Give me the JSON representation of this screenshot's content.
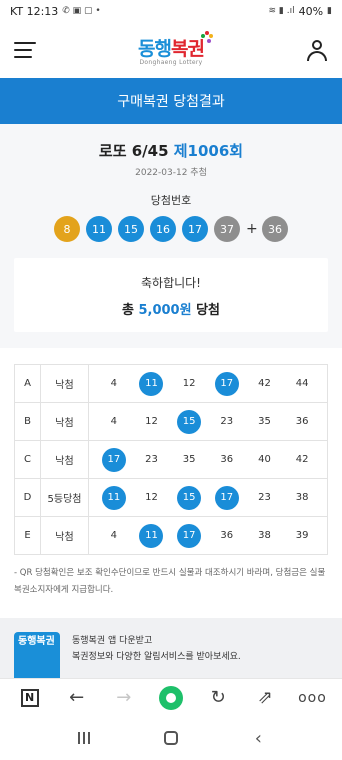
{
  "status_bar": {
    "carrier_time": "KT 12:13",
    "battery": "40%"
  },
  "header": {
    "logo_text_1": "동행",
    "logo_text_2": "복권",
    "logo_sub": "Donghaeng Lottery",
    "menu_icon": "hamburger-menu-icon",
    "user_icon": "user-icon"
  },
  "page_title": "구매복권 당첨결과",
  "draw": {
    "game": "로또 6/45",
    "round": "제1006회",
    "date": "2022-03-12 추첨",
    "winning_label": "당첨번호",
    "numbers": [
      {
        "n": "8",
        "color": "#e3a31c"
      },
      {
        "n": "11",
        "color": "#1a8dd8"
      },
      {
        "n": "15",
        "color": "#1a8dd8"
      },
      {
        "n": "16",
        "color": "#1a8dd8"
      },
      {
        "n": "17",
        "color": "#1a8dd8"
      },
      {
        "n": "37",
        "color": "#8e8e8e"
      }
    ],
    "plus": "+",
    "bonus": {
      "n": "36",
      "color": "#8e8e8e"
    }
  },
  "congrats": {
    "message": "축하합니다!",
    "prize_prefix": "총",
    "prize_amount": "5,000원",
    "prize_suffix": "당첨"
  },
  "ticket": {
    "rows": [
      {
        "letter": "A",
        "result": "낙첨",
        "numbers": [
          {
            "v": "4",
            "hit": false
          },
          {
            "v": "11",
            "hit": true
          },
          {
            "v": "12",
            "hit": false
          },
          {
            "v": "17",
            "hit": true
          },
          {
            "v": "42",
            "hit": false
          },
          {
            "v": "44",
            "hit": false
          }
        ]
      },
      {
        "letter": "B",
        "result": "낙첨",
        "numbers": [
          {
            "v": "4",
            "hit": false
          },
          {
            "v": "12",
            "hit": false
          },
          {
            "v": "15",
            "hit": true
          },
          {
            "v": "23",
            "hit": false
          },
          {
            "v": "35",
            "hit": false
          },
          {
            "v": "36",
            "hit": false
          }
        ]
      },
      {
        "letter": "C",
        "result": "낙첨",
        "numbers": [
          {
            "v": "17",
            "hit": true
          },
          {
            "v": "23",
            "hit": false
          },
          {
            "v": "35",
            "hit": false
          },
          {
            "v": "36",
            "hit": false
          },
          {
            "v": "40",
            "hit": false
          },
          {
            "v": "42",
            "hit": false
          }
        ]
      },
      {
        "letter": "D",
        "result": "5등당첨",
        "numbers": [
          {
            "v": "11",
            "hit": true
          },
          {
            "v": "12",
            "hit": false
          },
          {
            "v": "15",
            "hit": true
          },
          {
            "v": "17",
            "hit": true
          },
          {
            "v": "23",
            "hit": false
          },
          {
            "v": "38",
            "hit": false
          }
        ]
      },
      {
        "letter": "E",
        "result": "낙첨",
        "numbers": [
          {
            "v": "4",
            "hit": false
          },
          {
            "v": "11",
            "hit": true
          },
          {
            "v": "17",
            "hit": true
          },
          {
            "v": "36",
            "hit": false
          },
          {
            "v": "38",
            "hit": false
          },
          {
            "v": "39",
            "hit": false
          }
        ]
      }
    ]
  },
  "notice": "- QR 당첨확인은 보조 확인수단이므로 반드시 실물과 대조하시기 바라며, 당첨금은 실물 복권소지자에게 지급합니다.",
  "promo": {
    "icon_text": "동행복권",
    "line1": "동행복권 앱 다운받고",
    "line2": "복권정보와 다양한 알림서비스를 받아보세요."
  },
  "browser_bar": {
    "n_label": "N",
    "more_label": "ooo"
  },
  "colors": {
    "accent": "#1a7fd0",
    "ball_blue": "#1a8dd8",
    "ball_yellow": "#e3a31c",
    "ball_gray": "#8e8e8e"
  }
}
